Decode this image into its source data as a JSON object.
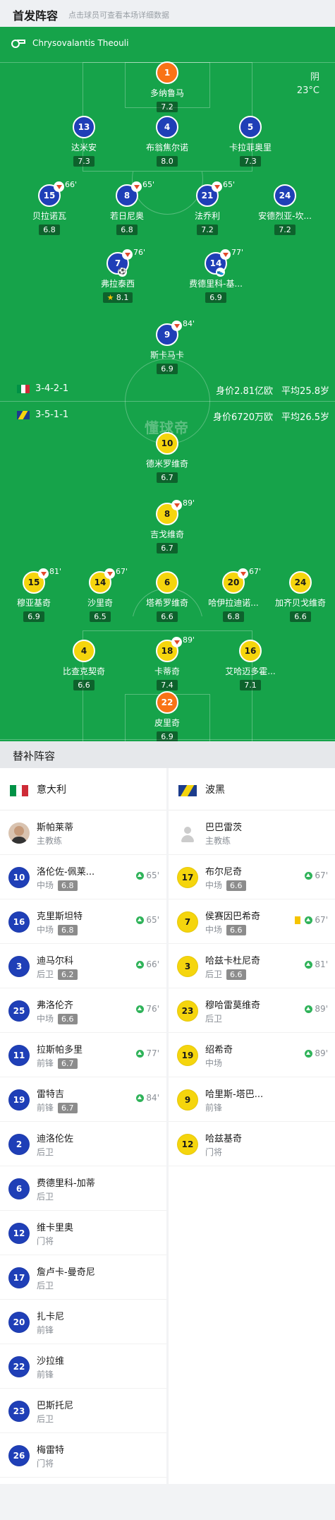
{
  "header": {
    "title": "首发阵容",
    "subtitle": "点击球员可查看本场详细数据"
  },
  "referee": {
    "name": "Chrysovalantis Theouli",
    "icon": "whistle-icon"
  },
  "weather": {
    "condition": "阴",
    "temp": "23°C"
  },
  "watermark": "懂球帝",
  "teams": {
    "home": {
      "name": "意大利",
      "formation": "3-4-2-1",
      "value": "身价2.81亿欧",
      "age": "平均25.8岁",
      "flag": [
        "#009246",
        "#ffffff",
        "#ce2b37"
      ]
    },
    "away": {
      "name": "波黑",
      "formation": "3-5-1-1",
      "value": "身价6720万欧",
      "age": "平均26.5岁"
    }
  },
  "colors": {
    "pitch": "#16a34a",
    "home": "#1f3fb7",
    "away": "#f5d50d",
    "keeper": "#f97316",
    "subArrow": "#e24a2a",
    "subIn": "#30b35a",
    "yellowCard": "#f5c400"
  },
  "lineup": [
    {
      "num": "1",
      "name": "多纳鲁马",
      "rating": "7.2",
      "type": "gk"
    },
    {
      "num": "13",
      "name": "达米安",
      "rating": "7.3",
      "type": "it"
    },
    {
      "num": "4",
      "name": "布翁焦尔诺",
      "rating": "8.0",
      "type": "it"
    },
    {
      "num": "5",
      "name": "卡拉菲奥里",
      "rating": "7.3",
      "type": "it"
    },
    {
      "num": "15",
      "name": "贝拉诺瓦",
      "rating": "6.8",
      "type": "it",
      "sub": "66'"
    },
    {
      "num": "8",
      "name": "若日尼奥",
      "rating": "6.8",
      "type": "it",
      "sub": "65'"
    },
    {
      "num": "21",
      "name": "法乔利",
      "rating": "7.2",
      "type": "it",
      "sub": "65'"
    },
    {
      "num": "24",
      "name": "安德烈亚-坎...",
      "rating": "7.2",
      "type": "it"
    },
    {
      "num": "7",
      "name": "弗拉泰西",
      "rating": "8.1",
      "type": "it",
      "sub": "76'",
      "goal": true,
      "star": true
    },
    {
      "num": "14",
      "name": "费德里科-基...",
      "rating": "6.9",
      "type": "it",
      "sub": "77'",
      "assist": true
    },
    {
      "num": "9",
      "name": "斯卡马卡",
      "rating": "6.9",
      "type": "it",
      "sub": "84'"
    },
    {
      "num": "10",
      "name": "德米罗维奇",
      "rating": "6.7",
      "type": "bo"
    },
    {
      "num": "8",
      "name": "吉戈维奇",
      "rating": "6.7",
      "type": "bo",
      "sub": "89'"
    },
    {
      "num": "15",
      "name": "穆亚基奇",
      "rating": "6.9",
      "type": "bo",
      "sub": "81'"
    },
    {
      "num": "14",
      "name": "沙里奇",
      "rating": "6.5",
      "type": "bo",
      "sub": "67'"
    },
    {
      "num": "6",
      "name": "塔希罗维奇",
      "rating": "6.6",
      "type": "bo"
    },
    {
      "num": "20",
      "name": "哈伊拉迪诺...",
      "rating": "6.8",
      "type": "bo",
      "sub": "67'"
    },
    {
      "num": "24",
      "name": "加齐贝戈维奇",
      "rating": "6.6",
      "type": "bo"
    },
    {
      "num": "4",
      "name": "比查克契奇",
      "rating": "6.6",
      "type": "bo"
    },
    {
      "num": "18",
      "name": "卡蒂奇",
      "rating": "7.4",
      "type": "bo",
      "sub": "89'"
    },
    {
      "num": "16",
      "name": "艾哈迈多霍...",
      "rating": "7.1",
      "type": "bo"
    },
    {
      "num": "22",
      "name": "皮里奇",
      "rating": "6.9",
      "type": "gk"
    }
  ],
  "subs_title": "替补阵容",
  "home_subs": {
    "coach": {
      "name": "斯帕莱蒂",
      "role": "主教练"
    },
    "players": [
      {
        "num": "10",
        "name": "洛伦佐-佩莱...",
        "pos": "中场",
        "rating": "6.8",
        "time": "65'"
      },
      {
        "num": "16",
        "name": "克里斯坦特",
        "pos": "中场",
        "rating": "6.8",
        "time": "65'"
      },
      {
        "num": "3",
        "name": "迪马尔科",
        "pos": "后卫",
        "rating": "6.2",
        "time": "66'"
      },
      {
        "num": "25",
        "name": "弗洛伦齐",
        "pos": "中场",
        "rating": "6.6",
        "time": "76'"
      },
      {
        "num": "11",
        "name": "拉斯帕多里",
        "pos": "前锋",
        "rating": "6.7",
        "time": "77'"
      },
      {
        "num": "19",
        "name": "雷特吉",
        "pos": "前锋",
        "rating": "6.7",
        "time": "84'"
      },
      {
        "num": "2",
        "name": "迪洛伦佐",
        "pos": "后卫"
      },
      {
        "num": "6",
        "name": "费德里科-加蒂",
        "pos": "后卫"
      },
      {
        "num": "12",
        "name": "维卡里奥",
        "pos": "门将"
      },
      {
        "num": "17",
        "name": "詹卢卡-曼奇尼",
        "pos": "后卫"
      },
      {
        "num": "20",
        "name": "扎卡尼",
        "pos": "前锋"
      },
      {
        "num": "22",
        "name": "沙拉维",
        "pos": "前锋"
      },
      {
        "num": "23",
        "name": "巴斯托尼",
        "pos": "后卫"
      },
      {
        "num": "26",
        "name": "梅雷特",
        "pos": "门将"
      }
    ]
  },
  "away_subs": {
    "coach": {
      "name": "巴巴雷茨",
      "role": "主教练"
    },
    "players": [
      {
        "num": "17",
        "name": "布尔尼奇",
        "pos": "中场",
        "rating": "6.6",
        "time": "67'"
      },
      {
        "num": "7",
        "name": "侯赛因巴希奇",
        "pos": "中场",
        "rating": "6.6",
        "time": "67'",
        "yellow": true
      },
      {
        "num": "3",
        "name": "哈兹卡杜尼奇",
        "pos": "后卫",
        "rating": "6.6",
        "time": "81'"
      },
      {
        "num": "23",
        "name": "穆哈雷莫维奇",
        "pos": "后卫",
        "time": "89'"
      },
      {
        "num": "19",
        "name": "绍希奇",
        "pos": "中场",
        "time": "89'"
      },
      {
        "num": "9",
        "name": "哈里斯-塔巴...",
        "pos": "前锋"
      },
      {
        "num": "12",
        "name": "哈兹基奇",
        "pos": "门将"
      }
    ]
  }
}
